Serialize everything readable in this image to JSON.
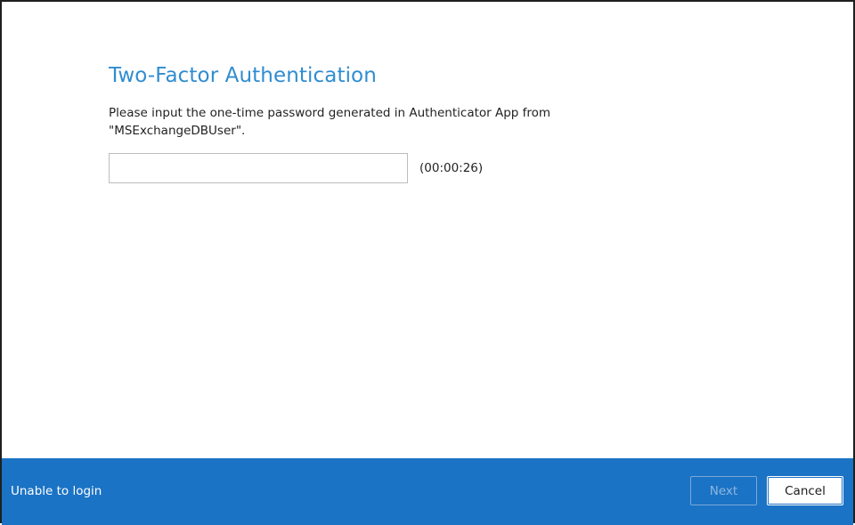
{
  "dialog": {
    "title": "Two-Factor Authentication",
    "instructions": "Please input the one-time password generated in Authenticator App from \"MSExchangeDBUser\".",
    "otp": {
      "value": "",
      "placeholder": ""
    },
    "timer": "(00:00:26)"
  },
  "footer": {
    "unable_to_login": "Unable to login",
    "next_label": "Next",
    "cancel_label": "Cancel",
    "accent_color": "#1b73c5"
  },
  "colors": {
    "title": "#2f8dd0",
    "footer_bg": "#1b73c5",
    "next_disabled_text": "#8fb6df"
  }
}
